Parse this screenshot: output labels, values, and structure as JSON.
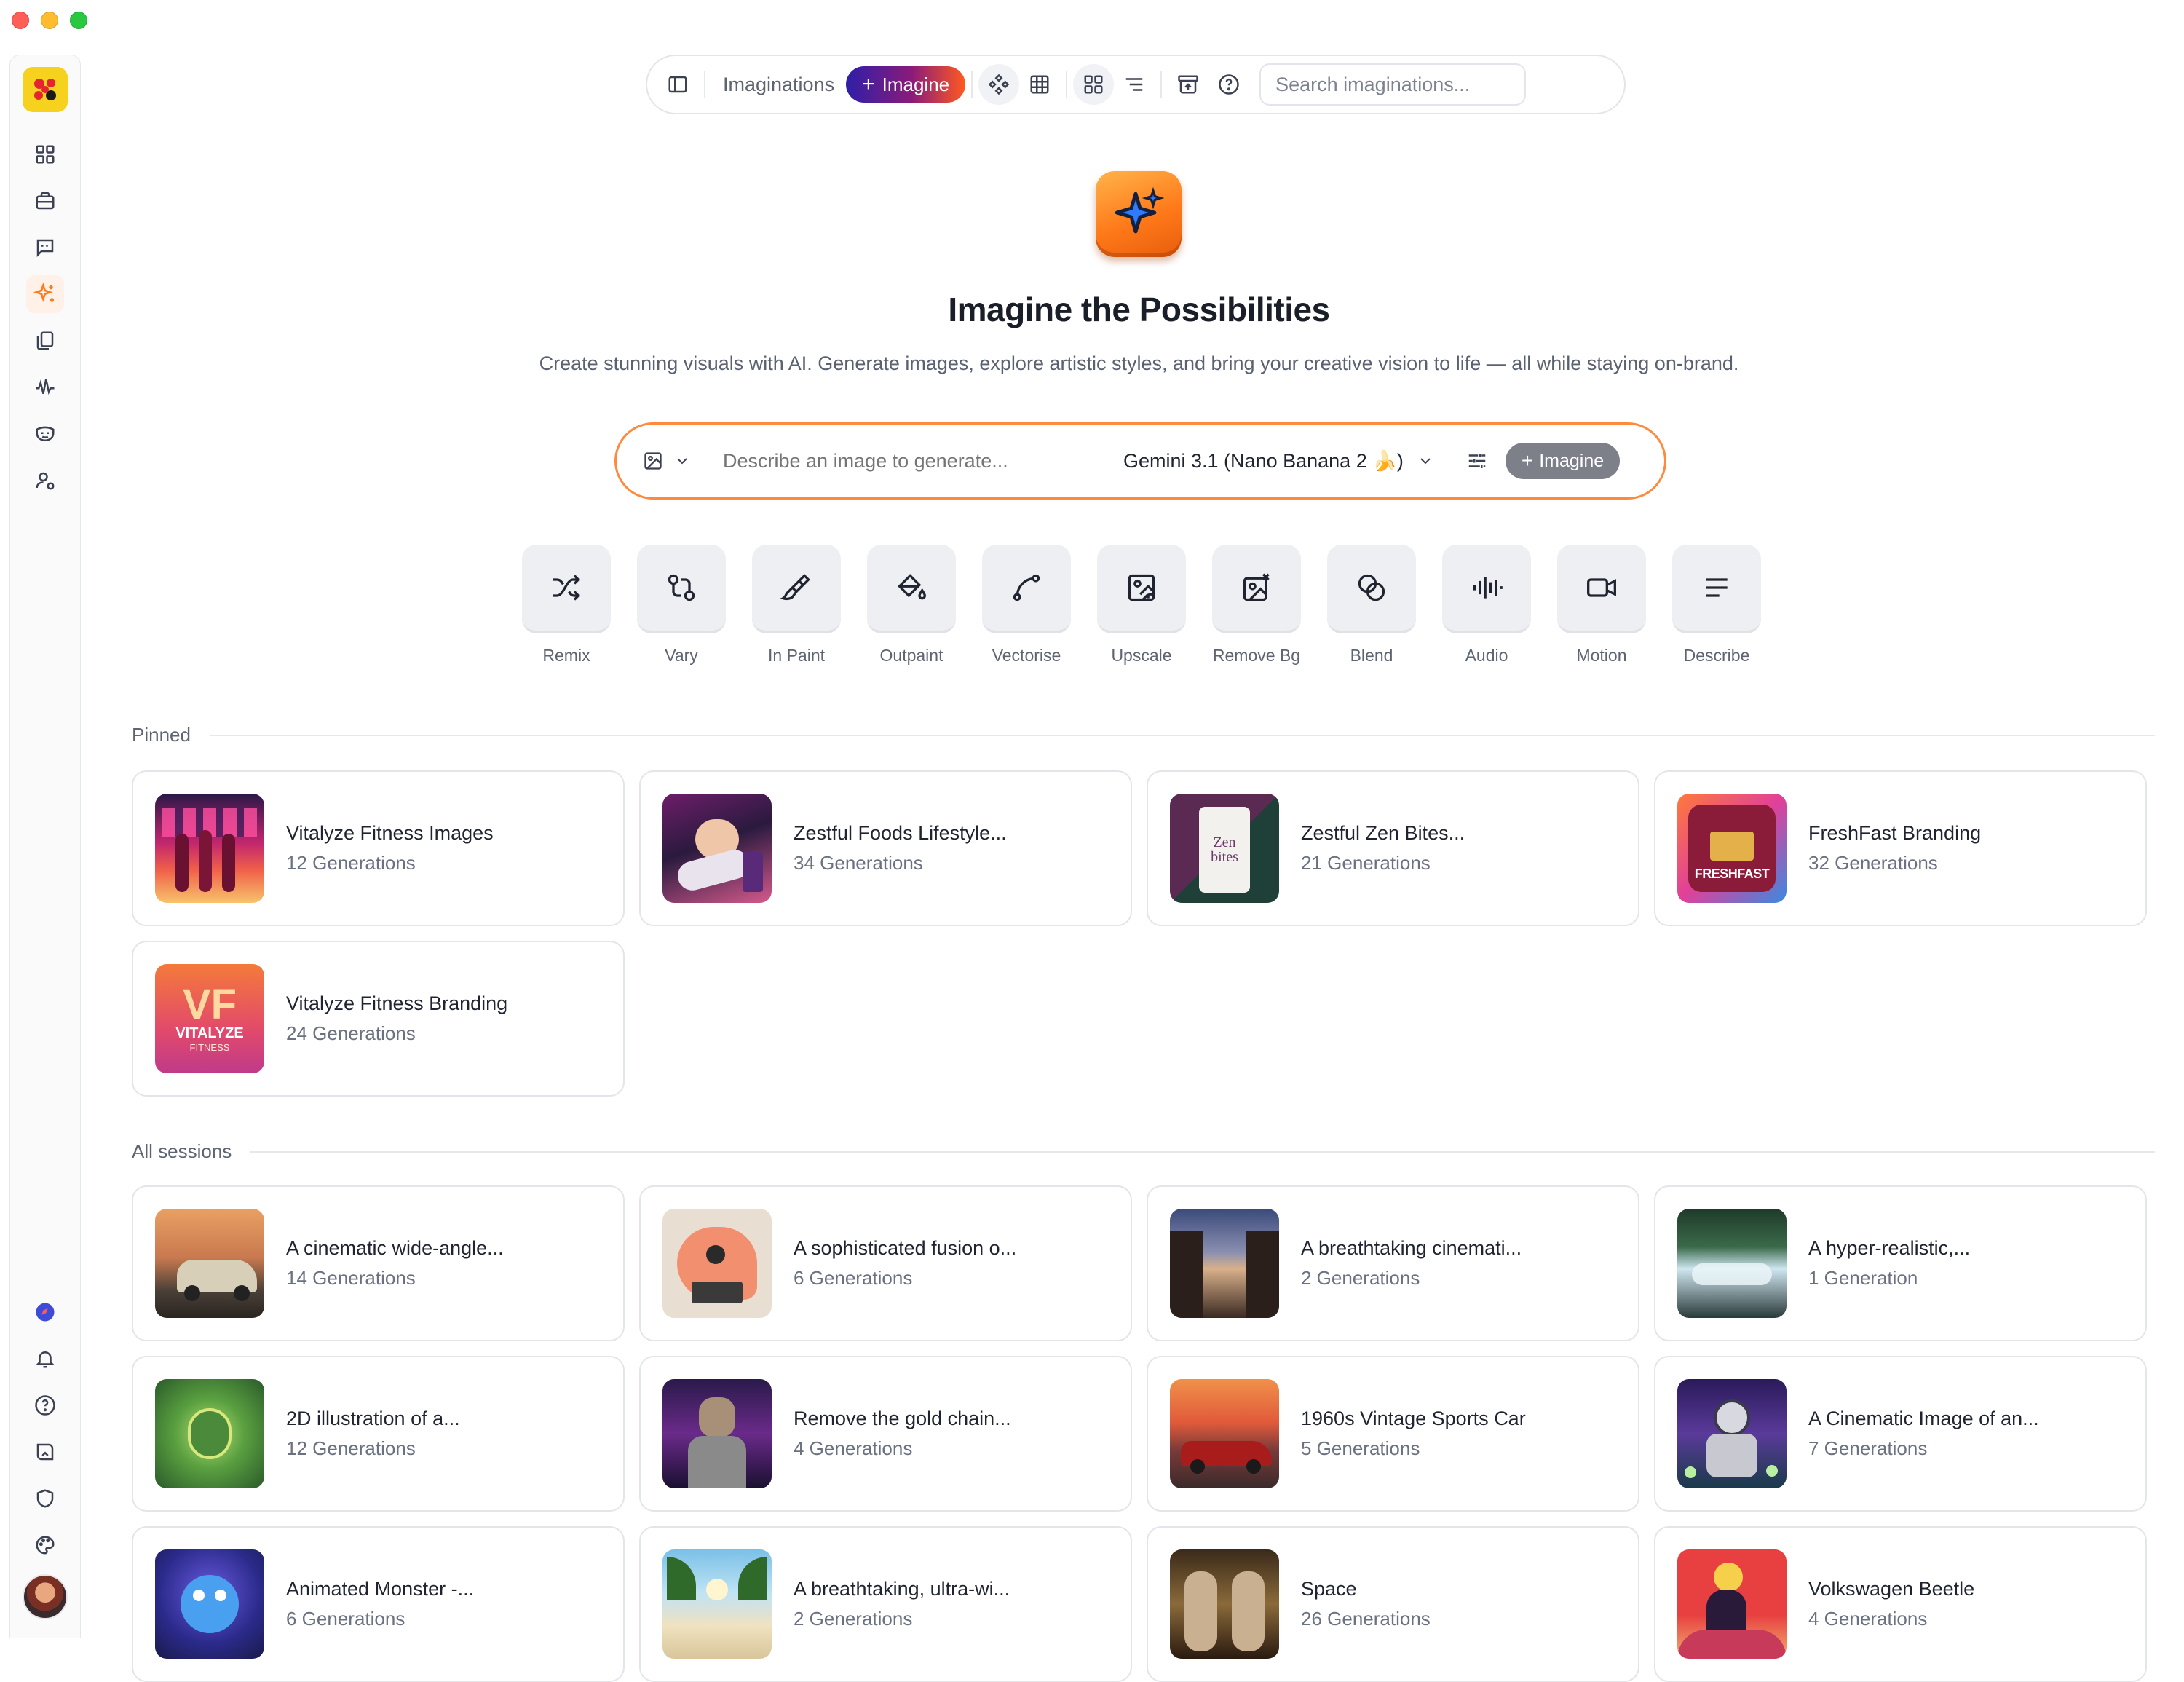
{
  "toolbar": {
    "imaginations_label": "Imaginations",
    "imagine_label": "Imagine",
    "search_placeholder": "Search imaginations..."
  },
  "hero": {
    "title": "Imagine the Possibilities",
    "subtitle": "Create stunning visuals with AI. Generate images, explore artistic styles, and bring your creative vision to life — all while staying on-brand."
  },
  "prompt": {
    "placeholder": "Describe an image to generate...",
    "model": "Gemini 3.1 (Nano Banana 2 🍌)",
    "imagine_label": "Imagine"
  },
  "tools": [
    {
      "label": "Remix",
      "icon": "shuffle-icon"
    },
    {
      "label": "Vary",
      "icon": "git-compare-icon"
    },
    {
      "label": "In Paint",
      "icon": "paintbrush-icon"
    },
    {
      "label": "Outpaint",
      "icon": "paint-bucket-icon"
    },
    {
      "label": "Vectorise",
      "icon": "bezier-curve-icon"
    },
    {
      "label": "Upscale",
      "icon": "image-upscale-icon"
    },
    {
      "label": "Remove Bg",
      "icon": "image-remove-bg-icon"
    },
    {
      "label": "Blend",
      "icon": "blend-icon"
    },
    {
      "label": "Audio",
      "icon": "audio-lines-icon"
    },
    {
      "label": "Motion",
      "icon": "video-icon"
    },
    {
      "label": "Describe",
      "icon": "text-align-icon"
    }
  ],
  "pinned": {
    "heading": "Pinned",
    "items": [
      {
        "title": "Vitalyze Fitness Images",
        "count": "12 Generations"
      },
      {
        "title": "Zestful Foods Lifestyle...",
        "count": "34 Generations"
      },
      {
        "title": "Zestful Zen Bites...",
        "count": "21 Generations"
      },
      {
        "title": "FreshFast Branding",
        "count": "32 Generations"
      },
      {
        "title": "Vitalyze Fitness Branding",
        "count": "24 Generations"
      }
    ]
  },
  "sessions": {
    "heading": "All sessions",
    "items": [
      {
        "title": "A cinematic wide-angle...",
        "count": "14 Generations"
      },
      {
        "title": "A sophisticated fusion o...",
        "count": "6 Generations"
      },
      {
        "title": "A breathtaking cinemati...",
        "count": "2 Generations"
      },
      {
        "title": "A hyper-realistic,...",
        "count": "1 Generation"
      },
      {
        "title": "2D illustration of a...",
        "count": "12 Generations"
      },
      {
        "title": "Remove the gold chain...",
        "count": "4 Generations"
      },
      {
        "title": "1960s Vintage Sports Car",
        "count": "5 Generations"
      },
      {
        "title": "A Cinematic Image of an...",
        "count": "7 Generations"
      },
      {
        "title": "Animated Monster -...",
        "count": "6 Generations"
      },
      {
        "title": "A breathtaking, ultra-wi...",
        "count": "2 Generations"
      },
      {
        "title": "Space",
        "count": "26 Generations"
      },
      {
        "title": "Volkswagen Beetle",
        "count": "4 Generations"
      }
    ]
  },
  "thumb_text": {
    "vitalyze_logo": "VF",
    "vitalyze_word": "VITALYZE",
    "vitalyze_sub": "FITNESS",
    "freshfast": "FRESHFAST",
    "zen_bites": "Zen bites"
  },
  "colors": {
    "accent": "#ff8a3d",
    "brand_gradient_start": "#2d1fa8",
    "brand_gradient_end": "#ff5a1f",
    "active_sidebar": "#ff7a1a"
  }
}
